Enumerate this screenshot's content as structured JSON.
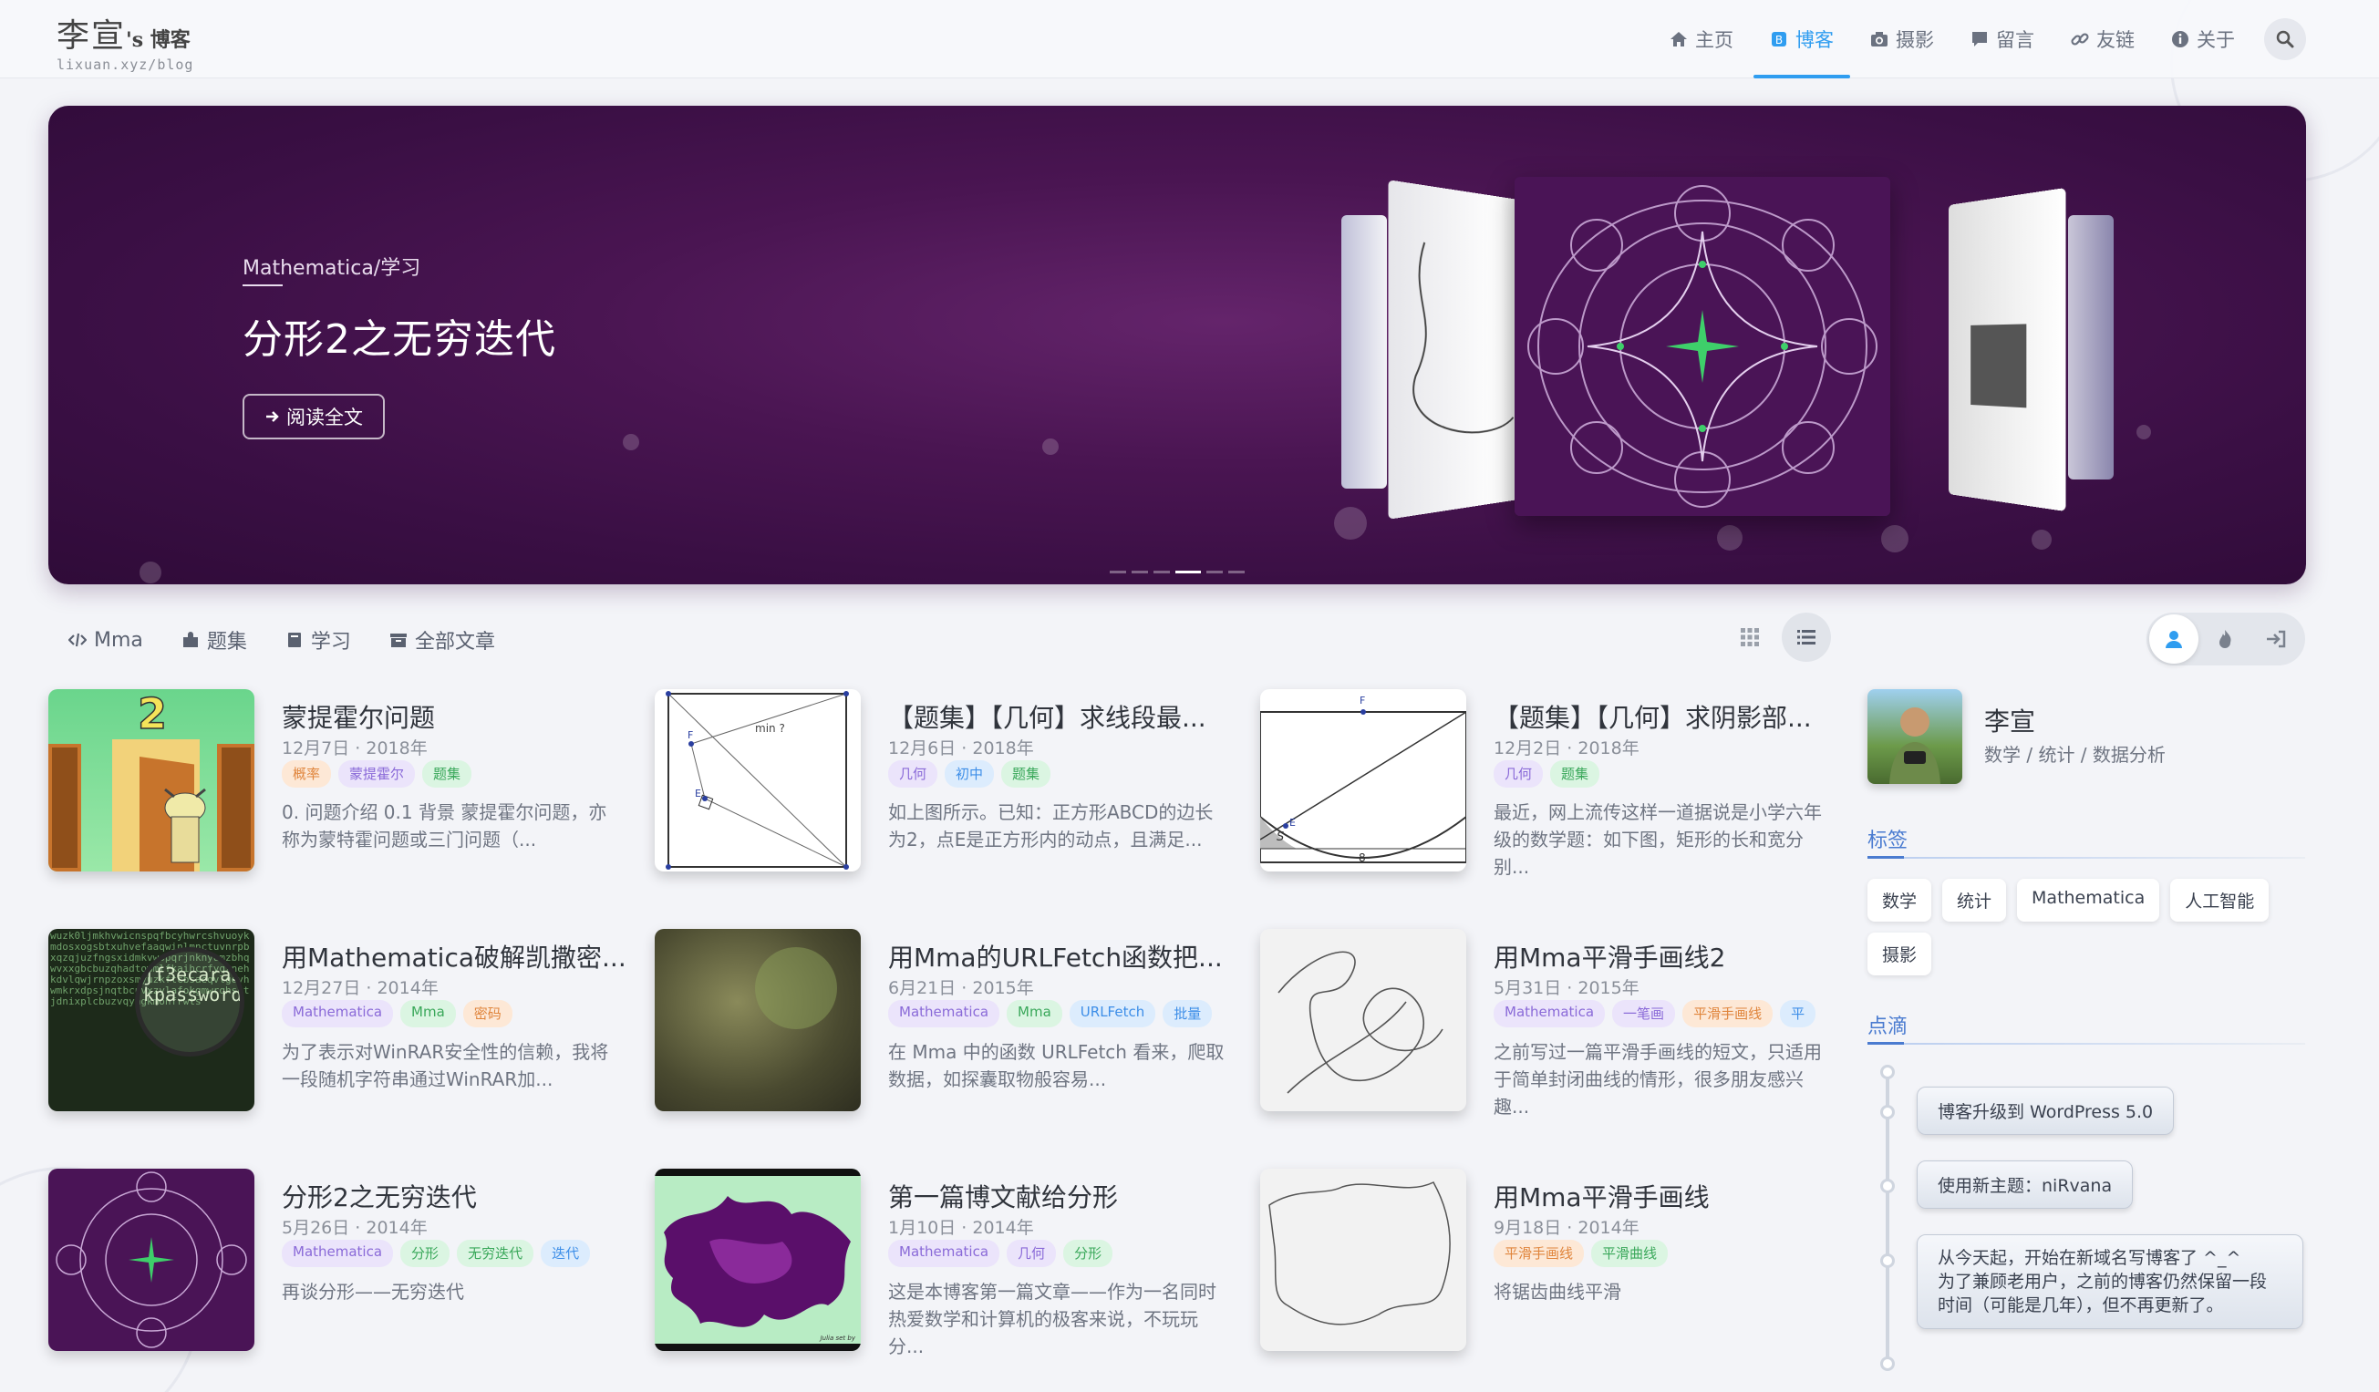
{
  "site": {
    "name": "李宣",
    "suffix": "'s 博客",
    "url": "lixuan.xyz/blog"
  },
  "nav": [
    {
      "label": "主页",
      "icon": "home-icon"
    },
    {
      "label": "博客",
      "icon": "blog-icon",
      "active": true
    },
    {
      "label": "摄影",
      "icon": "camera-icon"
    },
    {
      "label": "留言",
      "icon": "comment-icon"
    },
    {
      "label": "友链",
      "icon": "link-icon"
    },
    {
      "label": "关于",
      "icon": "info-icon"
    }
  ],
  "banner": {
    "category": "Mathematica/学习",
    "title": "分形2之无穷迭代",
    "button": "阅读全文",
    "slides": 6,
    "active_slide": 3
  },
  "filters": [
    {
      "label": "Mma",
      "icon": "code-icon"
    },
    {
      "label": "题集",
      "icon": "puzzle-icon"
    },
    {
      "label": "学习",
      "icon": "book-icon"
    },
    {
      "label": "全部文章",
      "icon": "archive-icon"
    }
  ],
  "posts": [
    {
      "title": "蒙提霍尔问题",
      "date": "12月7日 · 2018年",
      "tags": [
        "概率",
        "蒙提霍尔",
        "题集"
      ],
      "excerpt": "0. 问题介绍 0.1 背景 蒙提霍尔问题，亦称为蒙特霍问题或三门问题（..."
    },
    {
      "title": "【题集】【几何】求线段最...",
      "date": "12月6日 · 2018年",
      "tags": [
        "几何",
        "初中",
        "题集"
      ],
      "excerpt": "如上图所示。已知：正方形ABCD的边长为2，点E是正方形内的动点，且满足..."
    },
    {
      "title": "【题集】【几何】求阴影部...",
      "date": "12月2日 · 2018年",
      "tags": [
        "几何",
        "题集"
      ],
      "excerpt": "最近，网上流传这样一道据说是小学六年级的数学题：如下图，矩形的长和宽分别..."
    },
    {
      "title": "用Mathematica破解凯撒密...",
      "date": "12月27日 · 2014年",
      "tags": [
        "Mathematica",
        "Mma",
        "密码"
      ],
      "excerpt": "为了表示对WinRAR安全性的信赖，我将一段随机字符串通过WinRAR加..."
    },
    {
      "title": "用Mma的URLFetch函数把...",
      "date": "6月21日 · 2015年",
      "tags": [
        "Mathematica",
        "Mma",
        "URLFetch",
        "批量"
      ],
      "excerpt": "在 Mma 中的函数 URLFetch 看来，爬取数据，如探囊取物般容易..."
    },
    {
      "title": "用Mma平滑手画线2",
      "date": "5月31日 · 2015年",
      "tags": [
        "Mathematica",
        "一笔画",
        "平滑手画线",
        "平"
      ],
      "excerpt": "之前写过一篇平滑手画线的短文，只适用于简单封闭曲线的情形，很多朋友感兴趣..."
    },
    {
      "title": "分形2之无穷迭代",
      "date": "5月26日 · 2014年",
      "tags": [
        "Mathematica",
        "分形",
        "无穷迭代",
        "迭代"
      ],
      "excerpt": "再谈分形——无穷迭代"
    },
    {
      "title": "第一篇博文献给分形",
      "date": "1月10日 · 2014年",
      "tags": [
        "Mathematica",
        "几何",
        "分形"
      ],
      "excerpt": "这是本博客第一篇文章——作为一名同时热爱数学和计算机的极客来说，不玩玩分..."
    },
    {
      "title": "用Mma平滑手画线",
      "date": "9月18日 · 2014年",
      "tags": [
        "平滑手画线",
        "平滑曲线"
      ],
      "excerpt": "将锯齿曲线平滑"
    }
  ],
  "thumb_text": {
    "door_number": "2",
    "geom1": [
      "min ?",
      "E",
      "F"
    ],
    "geom2": [
      "F",
      "E",
      "S",
      "8"
    ],
    "cipher": "jf3ecaraskpassword",
    "fractal_caption": "Julia set by"
  },
  "sidebar": {
    "author_name": "李宣",
    "author_desc": "数学 / 统计 / 数据分析",
    "tags_title": "标签",
    "tags": [
      "数学",
      "统计",
      "Mathematica",
      "人工智能",
      "摄影"
    ],
    "notes_title": "点滴",
    "notes": [
      "博客升级到 WordPress 5.0",
      "使用新主题：niRvana",
      "从今天起，开始在新域名写博客了 ^_^",
      "为了兼顾老用户，之前的博客仍然保留一段时间（可能是几年），但不再更新了。"
    ]
  },
  "colors": {
    "accent": "#2f9df0",
    "banner": "#4a1552",
    "tag_blue": "#3d8ee8",
    "tag_green": "#3aa85a",
    "tag_purple": "#8a6ad8",
    "tag_orange": "#e0853c"
  }
}
